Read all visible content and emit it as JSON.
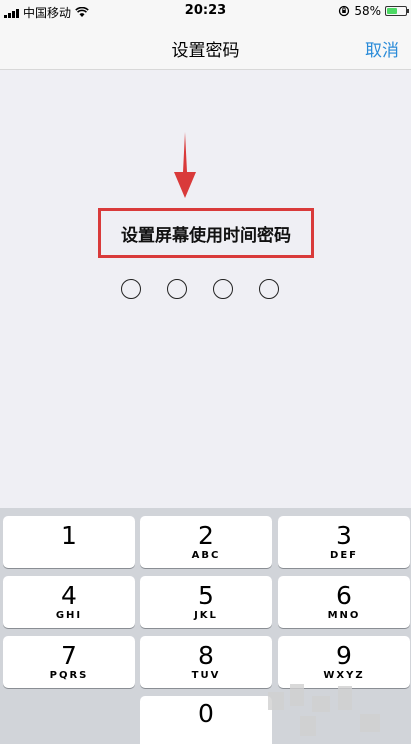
{
  "status_bar": {
    "carrier": "中国移动",
    "time": "20:23",
    "battery_percent": "58%",
    "battery_level": 0.58
  },
  "nav": {
    "title": "设置密码",
    "cancel_label": "取消"
  },
  "prompt": {
    "text": "设置屏幕使用时间密码",
    "highlight_color": "#d93a3a",
    "passcode_length": 4
  },
  "keypad": {
    "keys": [
      {
        "num": "1",
        "letters": ""
      },
      {
        "num": "2",
        "letters": "ABC"
      },
      {
        "num": "3",
        "letters": "DEF"
      },
      {
        "num": "4",
        "letters": "GHI"
      },
      {
        "num": "5",
        "letters": "JKL"
      },
      {
        "num": "6",
        "letters": "MNO"
      },
      {
        "num": "7",
        "letters": "PQRS"
      },
      {
        "num": "8",
        "letters": "TUV"
      },
      {
        "num": "9",
        "letters": "WXYZ"
      },
      {
        "num": "0",
        "letters": ""
      }
    ]
  },
  "colors": {
    "accent": "#2a8bd8",
    "background": "#efeff4",
    "keypad_bg": "#d1d4d9"
  }
}
